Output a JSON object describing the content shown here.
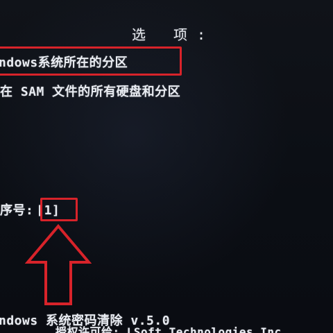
{
  "screen": {
    "title": "选 项:",
    "option_1": "ndows系统所在的分区",
    "option_2": "在 SAM 文件的所有硬盘和分区",
    "prompt_label": "序号:",
    "prompt_value": "[1]",
    "footer_line_1": "ndows 系统密码清除 v.5.0",
    "footer_line_2": "授权许可给: LSoft Technologies Inc"
  },
  "colors": {
    "background": "#0d0f16",
    "text": "#e9ecf2",
    "highlight": "#d8232a"
  }
}
